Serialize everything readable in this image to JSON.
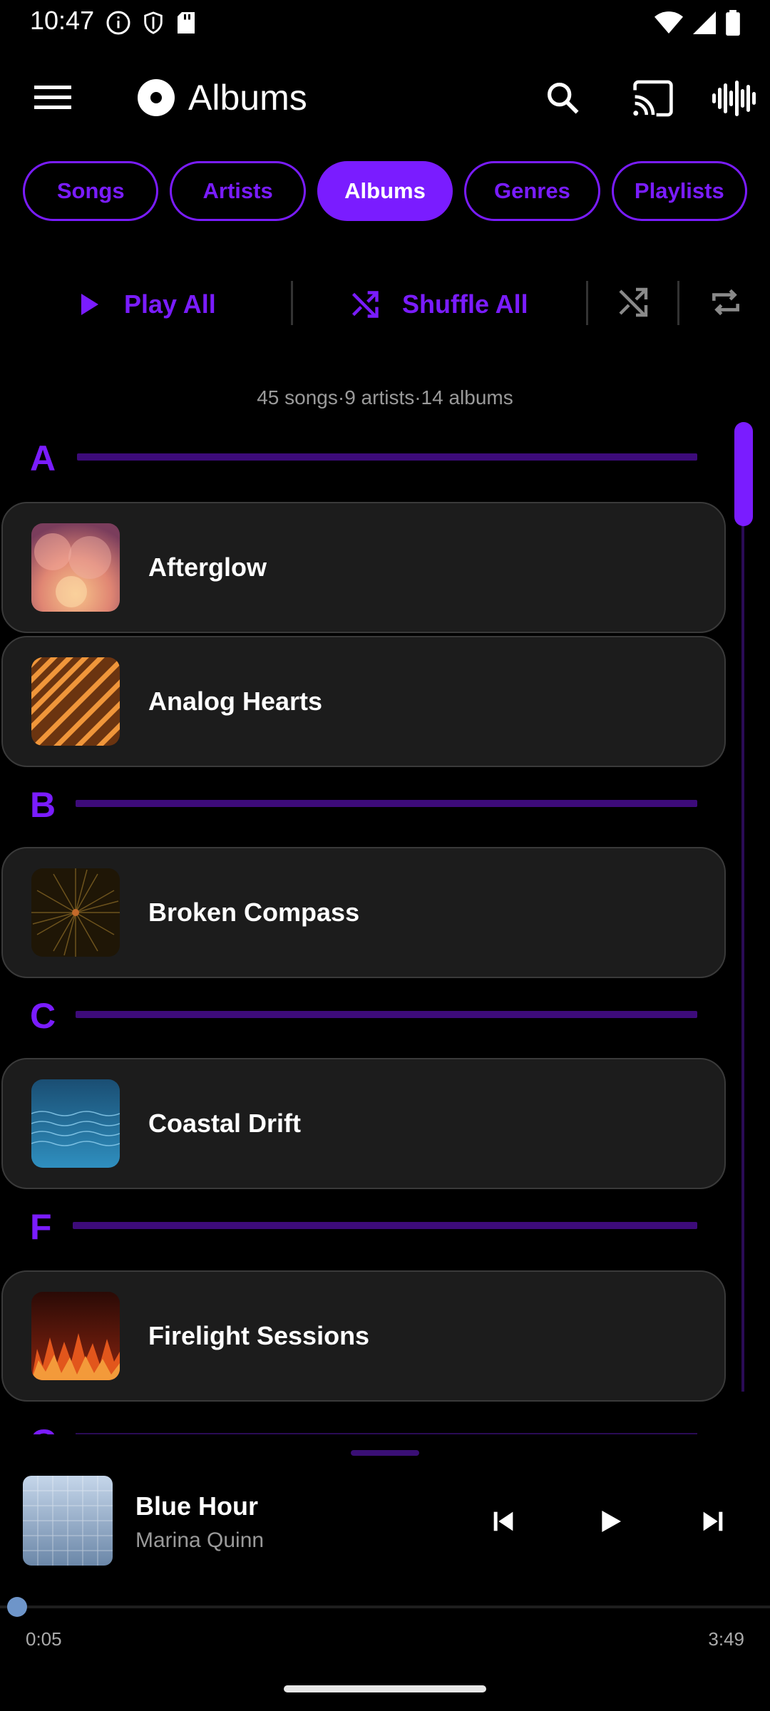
{
  "status": {
    "time": "10:47"
  },
  "header": {
    "title": "Albums"
  },
  "tabs": [
    {
      "label": "Songs"
    },
    {
      "label": "Artists"
    },
    {
      "label": "Albums",
      "active": true
    },
    {
      "label": "Genres"
    },
    {
      "label": "Playlists"
    }
  ],
  "actions": {
    "play_all": "Play All",
    "shuffle_all": "Shuffle All"
  },
  "summary": "45 songs·9 artists·14 albums",
  "sections": [
    {
      "letter": "A",
      "albums": [
        "Afterglow",
        "Analog Hearts"
      ]
    },
    {
      "letter": "B",
      "albums": [
        "Broken Compass"
      ]
    },
    {
      "letter": "C",
      "albums": [
        "Coastal Drift"
      ]
    },
    {
      "letter": "F",
      "albums": [
        "Firelight Sessions"
      ]
    },
    {
      "letter": "G",
      "albums": []
    }
  ],
  "now_playing": {
    "title": "Blue Hour",
    "artist": "Marina Quinn",
    "elapsed": "0:05",
    "total": "3:49",
    "progress": 0.02
  },
  "colors": {
    "accent": "#7a1cff",
    "section_line": "#3d0b7a",
    "card_bg": "#1c1c1c"
  }
}
